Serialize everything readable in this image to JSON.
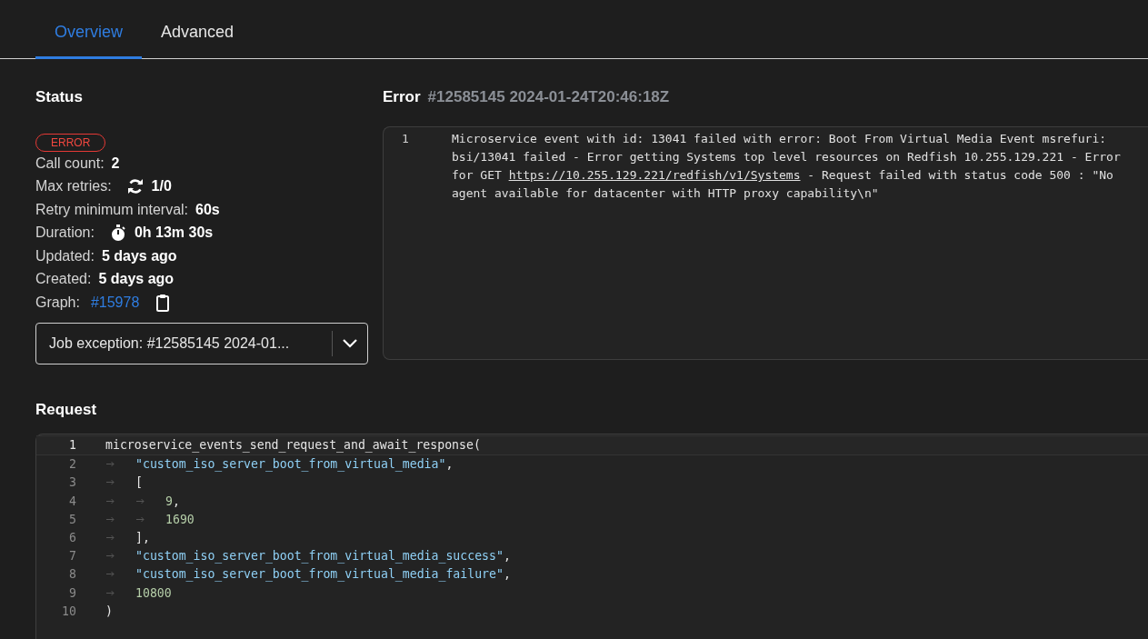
{
  "tabs": [
    {
      "label": "Overview",
      "selected": true
    },
    {
      "label": "Advanced",
      "selected": false
    }
  ],
  "status": {
    "title": "Status",
    "badge": "ERROR",
    "fields": [
      {
        "kind": "plain",
        "label": "Call count:",
        "value": "2"
      },
      {
        "kind": "retry",
        "label": "Max retries:",
        "value": "1/0"
      },
      {
        "kind": "plain",
        "label": "Retry minimum interval:",
        "value": "60s"
      },
      {
        "kind": "timer",
        "label": "Duration:",
        "value": "0h 13m 30s"
      },
      {
        "kind": "plain",
        "label": "Updated:",
        "value": "5 days ago"
      },
      {
        "kind": "plain",
        "label": "Created:",
        "value": "5 days ago"
      },
      {
        "kind": "link",
        "label": "Graph:",
        "value": "#15978"
      }
    ],
    "dropdown": "Job exception: #12585145 2024-01..."
  },
  "error": {
    "title": "Error",
    "subtitle": "#12585145 2024-01-24T20:46:18Z",
    "line_number": "1",
    "before": "Microservice event with id: 13041 failed with error: Boot From Virtual Media Event msrefuri: bsi/13041 failed - Error getting Systems top level resources on Redfish 10.255.129.221 - Error for GET ",
    "link": "https://10.255.129.221/redfish/v1/Systems",
    "after": " - Request failed with status code 500 : \"No agent available for datacenter with HTTP proxy capability\\n\""
  },
  "request": {
    "title": "Request",
    "lines": [
      {
        "number": "1",
        "tokens": [
          {
            "kind": "plain",
            "text": "microservice_events_send_request_and_await_response("
          }
        ]
      },
      {
        "number": "2",
        "tokens": [
          {
            "kind": "indent"
          },
          {
            "kind": "string",
            "text": "\"custom_iso_server_boot_from_virtual_media\""
          },
          {
            "kind": "plain",
            "text": ","
          }
        ]
      },
      {
        "number": "3",
        "tokens": [
          {
            "kind": "indent"
          },
          {
            "kind": "plain",
            "text": "["
          }
        ]
      },
      {
        "number": "4",
        "tokens": [
          {
            "kind": "indent"
          },
          {
            "kind": "indent"
          },
          {
            "kind": "number",
            "text": "9"
          },
          {
            "kind": "plain",
            "text": ","
          }
        ]
      },
      {
        "number": "5",
        "tokens": [
          {
            "kind": "indent"
          },
          {
            "kind": "indent"
          },
          {
            "kind": "number",
            "text": "1690"
          }
        ]
      },
      {
        "number": "6",
        "tokens": [
          {
            "kind": "indent"
          },
          {
            "kind": "plain",
            "text": "],"
          }
        ]
      },
      {
        "number": "7",
        "tokens": [
          {
            "kind": "indent"
          },
          {
            "kind": "string",
            "text": "\"custom_iso_server_boot_from_virtual_media_success\""
          },
          {
            "kind": "plain",
            "text": ","
          }
        ]
      },
      {
        "number": "8",
        "tokens": [
          {
            "kind": "indent"
          },
          {
            "kind": "string",
            "text": "\"custom_iso_server_boot_from_virtual_media_failure\""
          },
          {
            "kind": "plain",
            "text": ","
          }
        ]
      },
      {
        "number": "9",
        "tokens": [
          {
            "kind": "indent"
          },
          {
            "kind": "number",
            "text": "10800"
          }
        ]
      },
      {
        "number": "10",
        "tokens": [
          {
            "kind": "plain",
            "text": ")"
          }
        ]
      }
    ]
  }
}
